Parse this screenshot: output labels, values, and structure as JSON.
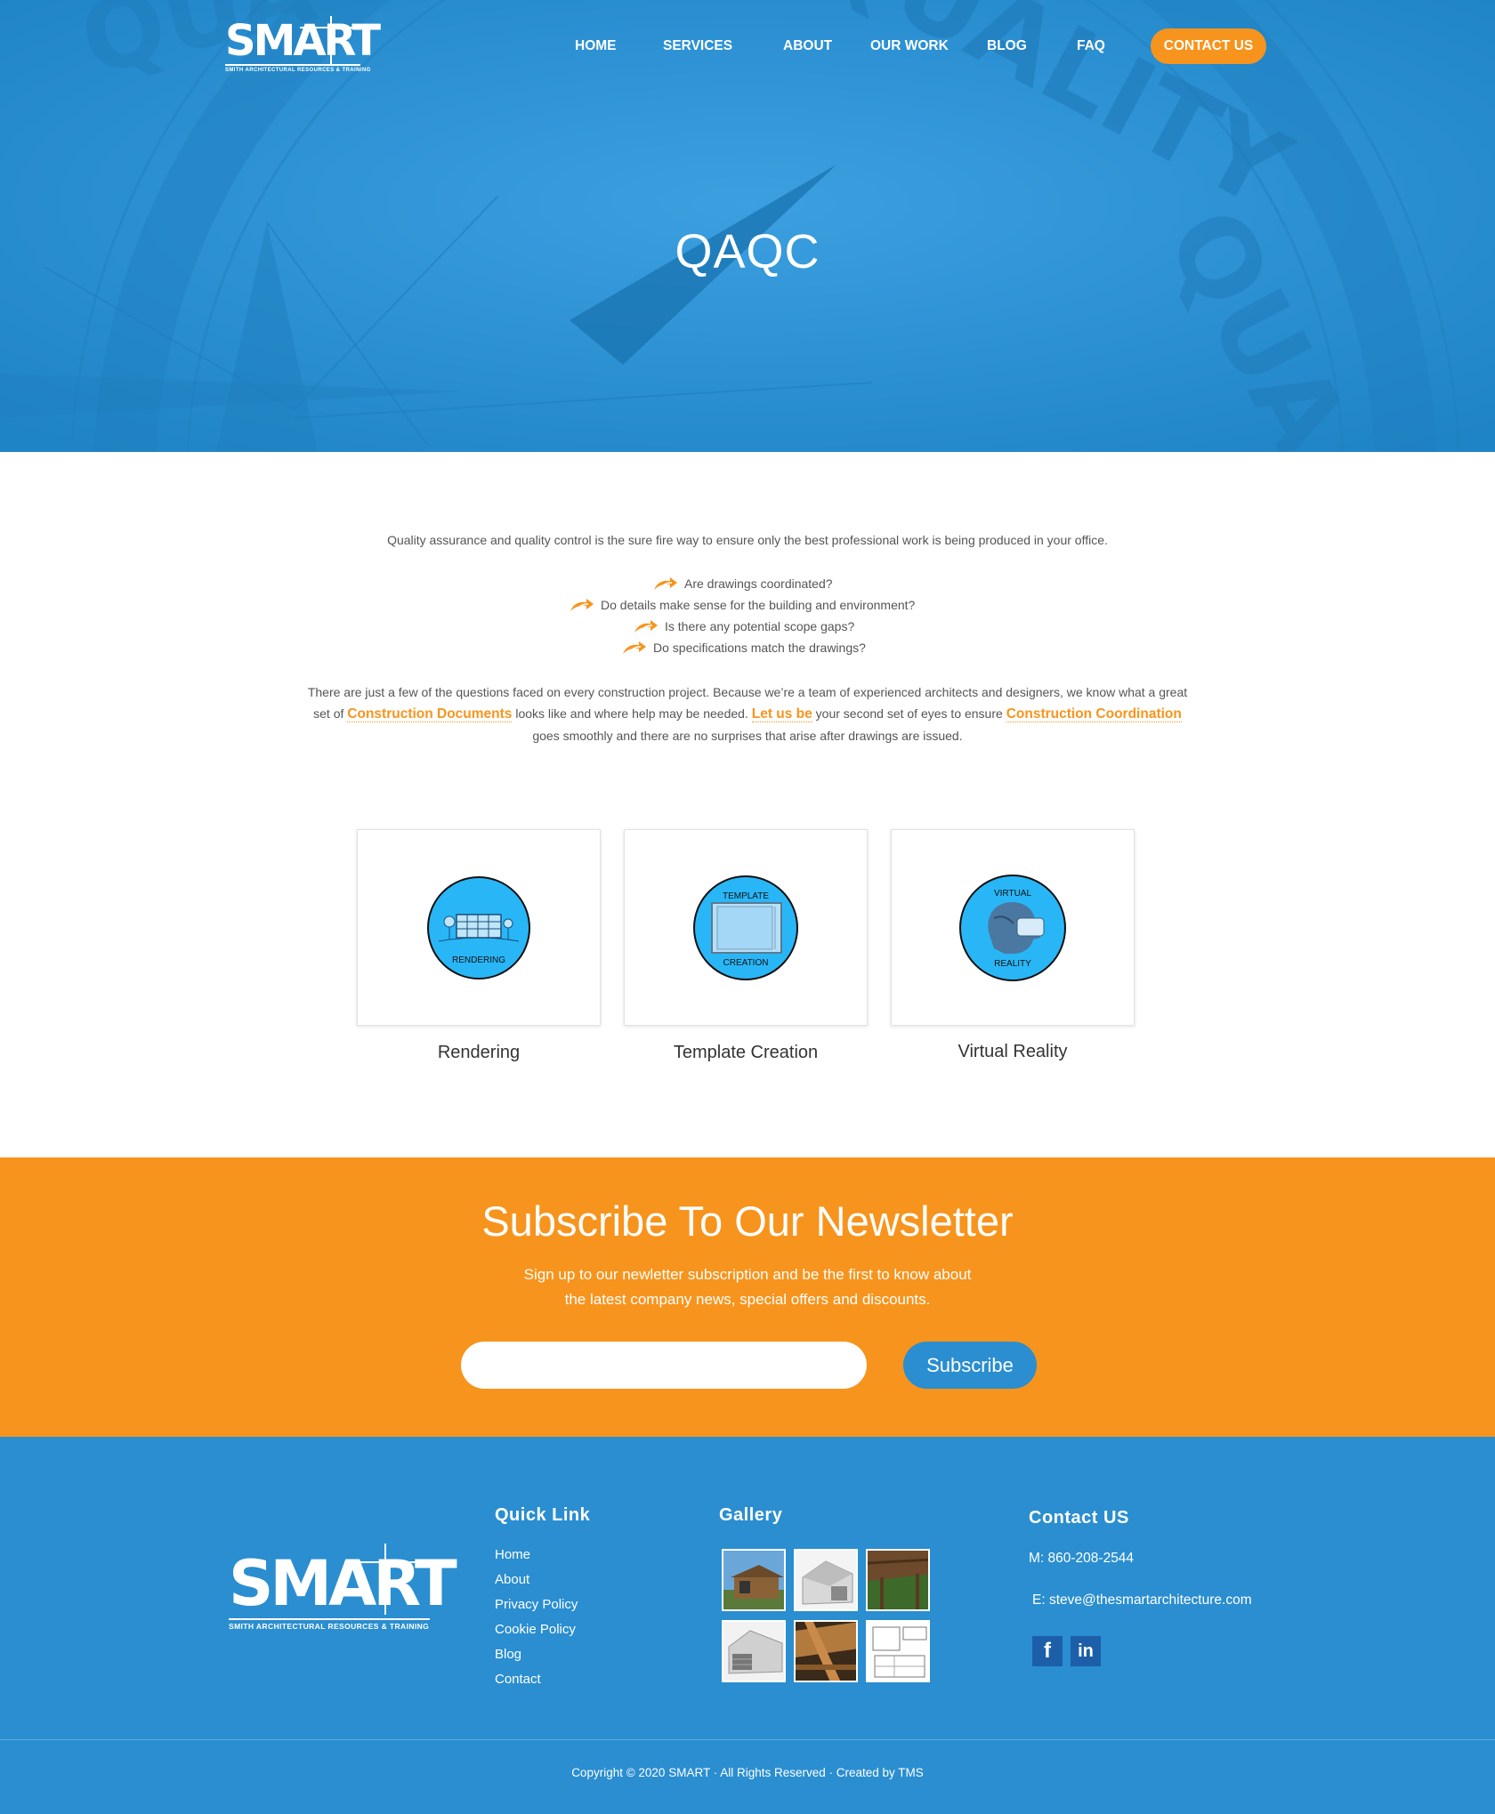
{
  "brand": {
    "logo_text": "SMART",
    "logo_tagline": "SMITH ARCHITECTURAL RESOURCES & TRAINING"
  },
  "nav": {
    "items": [
      "HOME",
      "SERVICES",
      "ABOUT",
      "OUR WORK",
      "BLOG",
      "FAQ"
    ],
    "contact_label": "CONTACT US"
  },
  "hero": {
    "title": "QAQC",
    "background_words": "QUALITY"
  },
  "content": {
    "intro": "Quality assurance and quality control is the sure fire way to ensure only the best professional work is being produced in your office.",
    "questions": [
      "Are drawings coordinated?",
      "Do details make sense for the building and environment?",
      "Is there any potential scope gaps?",
      "Do specifications match the drawings?"
    ],
    "para_part1": "There are just a few of the questions faced on every construction project. Because we’re a team of experienced architects and designers, we know what a great set of",
    "link1": "Construction Documents",
    "para_part2": "looks like and where help may be needed.",
    "link2": "Let us be",
    "para_part3": "your second set of eyes to ensure",
    "link3": "Construction Coor­dination",
    "para_part4": "goes smoothly and there are no surprises that arise after drawings are issued."
  },
  "services": [
    {
      "label": "Rendering",
      "icon_text_bottom": "RENDERING",
      "icon_text_top": ""
    },
    {
      "label": "Template Creation",
      "icon_text_top": "TEMPLATE",
      "icon_text_bottom": "CREATION"
    },
    {
      "label": "Virtual Reality",
      "icon_text_top": "VIRTUAL",
      "icon_text_bottom": "REALITY"
    }
  ],
  "newsletter": {
    "title": "Subscribe To Our Newsletter",
    "subtitle_line1": "Sign up to our newletter subscription and be the first to know about",
    "subtitle_line2": "the latest company news, special offers and discounts.",
    "input_placeholder": "",
    "button_label": "Subscribe"
  },
  "footer": {
    "quick_link_heading": "Quick Link",
    "quick_links": [
      "Home",
      "About",
      "Privacy Policy",
      "Cookie Policy",
      "Blog",
      "Contact"
    ],
    "gallery_heading": "Gallery",
    "contact_heading": "Contact US",
    "phone": "M: 860-208-2544",
    "email": "E: steve@thesmartarchitecture.com",
    "social": [
      "f",
      "in"
    ],
    "copyright": "Copyright © 2020 SMART · All Rights Reserved · Created by TMS"
  },
  "colors": {
    "primary_blue": "#2a8ed0",
    "accent_orange": "#f7941d",
    "icon_blue": "#29b6f6"
  },
  "icons": {
    "question_bullet": "double-arrow-icon",
    "social_facebook": "facebook-icon",
    "social_linkedin": "linkedin-icon"
  }
}
